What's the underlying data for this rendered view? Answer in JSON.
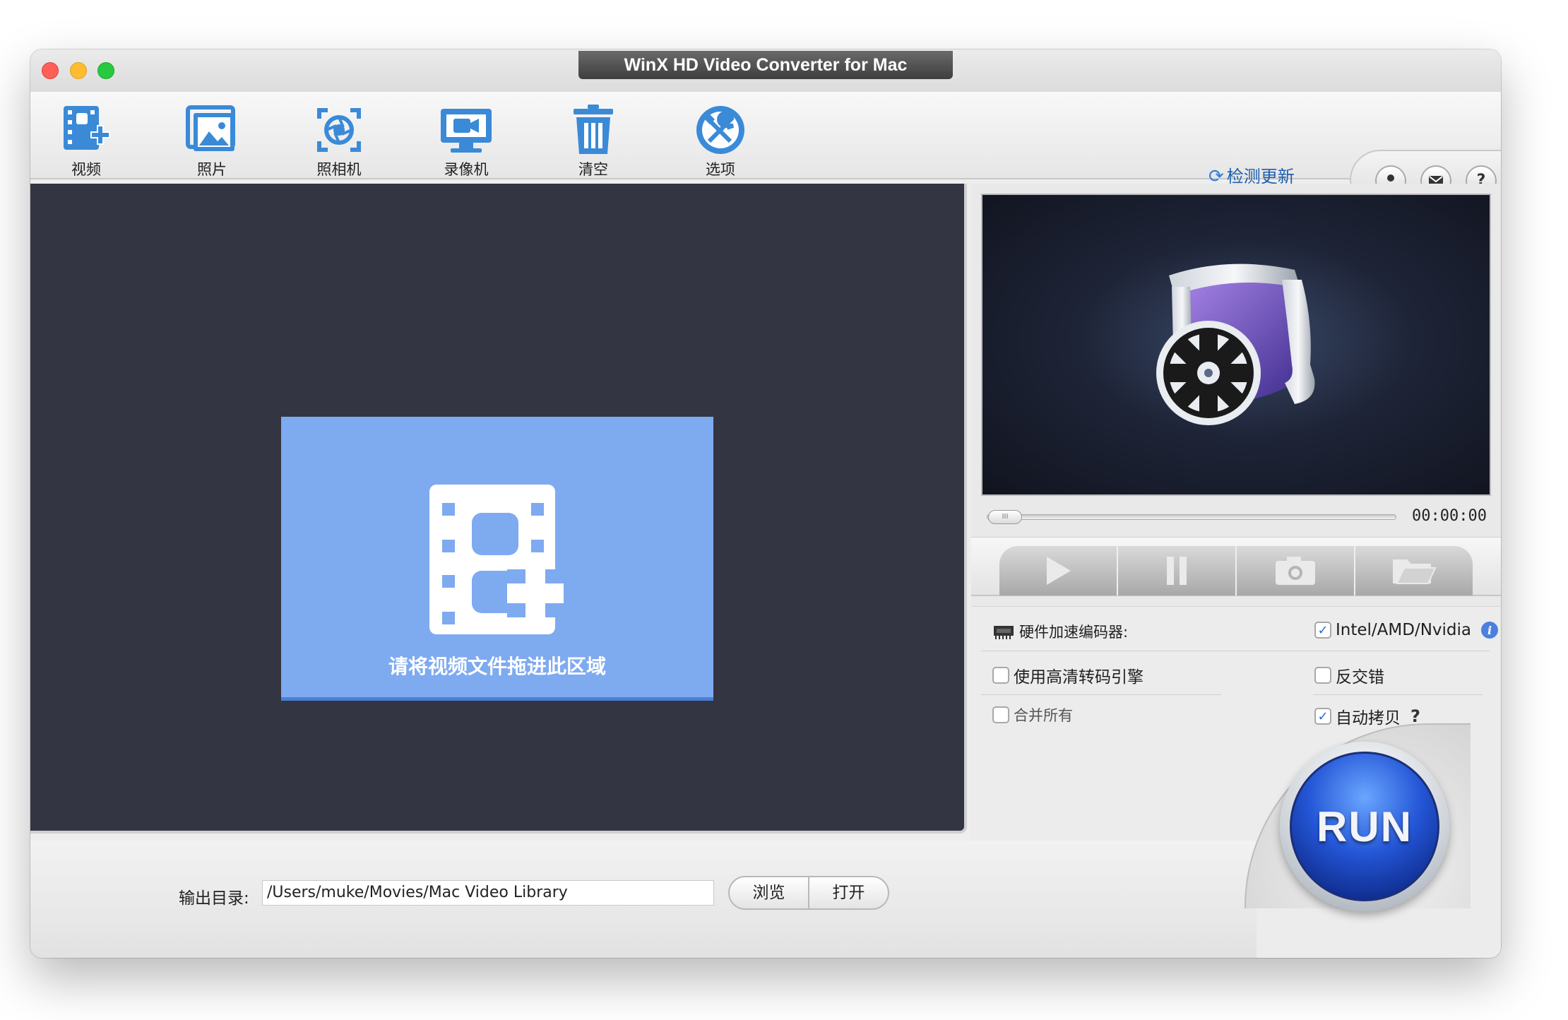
{
  "window": {
    "title": "WinX HD Video Converter for Mac"
  },
  "toolbar": {
    "items": [
      {
        "label": "视频",
        "icon": "add-video-icon"
      },
      {
        "label": "照片",
        "icon": "photo-icon"
      },
      {
        "label": "照相机",
        "icon": "camera-icon"
      },
      {
        "label": "录像机",
        "icon": "screen-recorder-icon"
      },
      {
        "label": "清空",
        "icon": "trash-icon"
      },
      {
        "label": "选项",
        "icon": "options-icon"
      }
    ],
    "update_link": "检测更新"
  },
  "drop_zone": {
    "text": "请将视频文件拖进此区域"
  },
  "player": {
    "time": "00:00:00",
    "seek_position": 0
  },
  "options": {
    "hw_encoder_label": "硬件加速编码器:",
    "hw_encoder_option": "Intel/AMD/Nvidia",
    "hw_encoder_checked": true,
    "hd_engine": "使用高清转码引擎",
    "hd_engine_checked": false,
    "deinterlace": "反交错",
    "deinterlace_checked": false,
    "merge_all": "合并所有",
    "merge_all_checked": false,
    "auto_copy": "自动拷贝",
    "auto_copy_checked": true,
    "help": "?"
  },
  "output": {
    "label": "输出目录:",
    "path": "/Users/muke/Movies/Mac Video Library",
    "browse": "浏览",
    "open": "打开"
  },
  "run": {
    "label": "RUN"
  },
  "colors": {
    "accent": "#3a8ad8",
    "drop_zone": "#7eaaf0",
    "panel_dark": "#343542",
    "run_blue": "#2456d6"
  }
}
